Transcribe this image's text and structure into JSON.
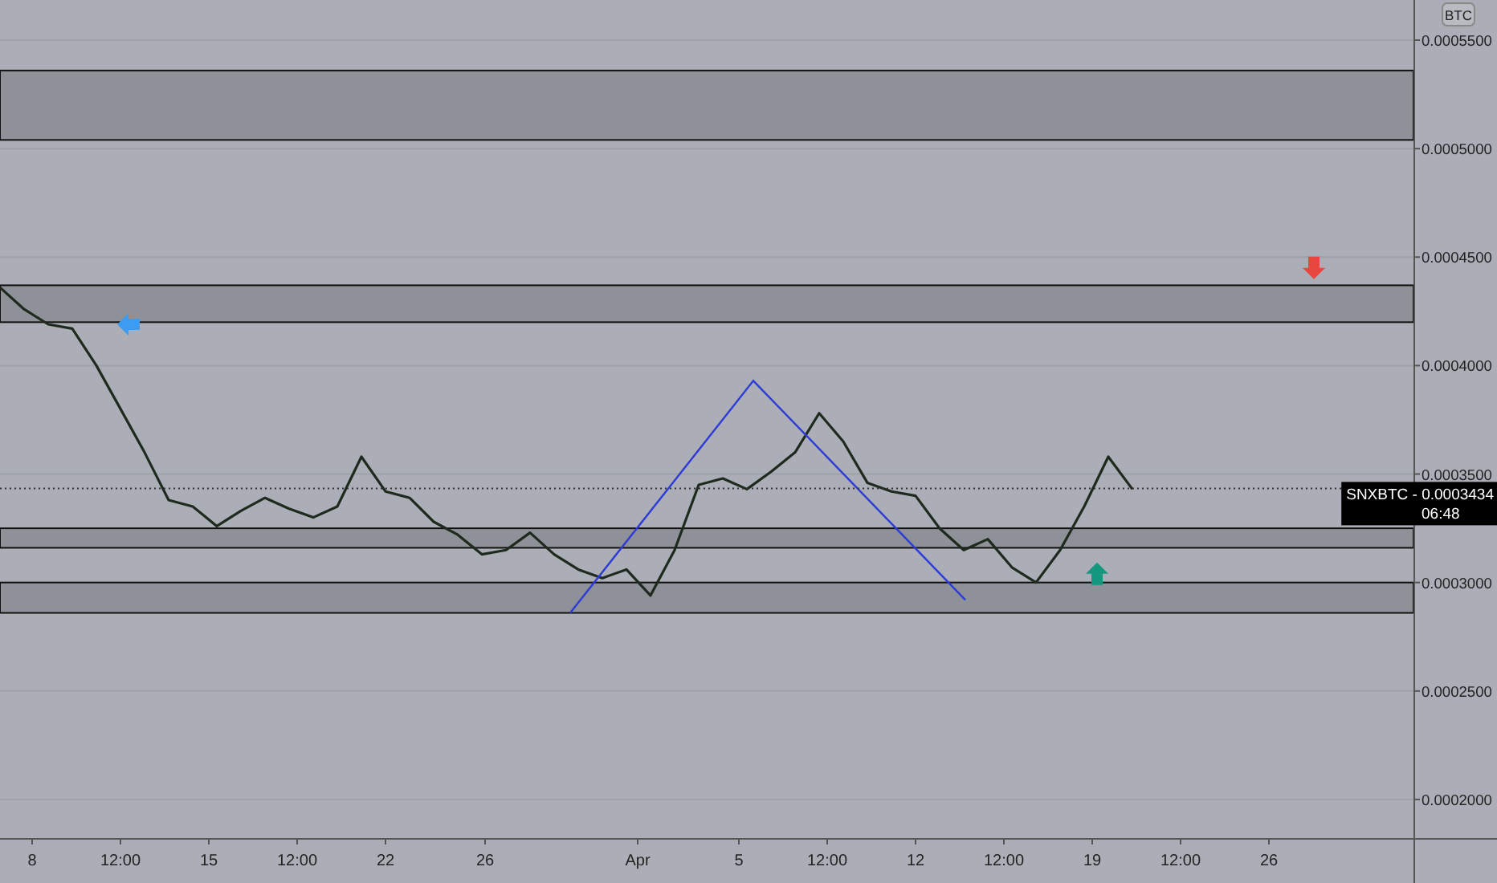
{
  "chart": {
    "currency_button": "BTC",
    "chart_data": {
      "type": "line",
      "grid": true,
      "series": [
        {
          "color": "#1e2a1e",
          "values": [
            0.000436,
            0.000426,
            0.000419,
            0.000417,
            0.0004,
            0.00038,
            0.00036,
            0.000338,
            0.000335,
            0.000326,
            0.000333,
            0.000339,
            0.000334,
            0.00033,
            0.000335,
            0.000358,
            0.000342,
            0.000339,
            0.000328,
            0.000322,
            0.000313,
            0.000315,
            0.000323,
            0.000313,
            0.000306,
            0.000302,
            0.000306,
            0.000294,
            0.000315,
            0.000345,
            0.000348,
            0.000343,
            0.000351,
            0.00036,
            0.000378,
            0.000365,
            0.000346,
            0.000342,
            0.00034,
            0.000325,
            0.000315,
            0.00032,
            0.000307,
            0.0003,
            0.000315,
            0.000335,
            0.000358,
            0.000343
          ]
        }
      ],
      "ylim": [
        0.0001615,
        0.0005685
      ],
      "yticks": [
        {
          "value": 0.00055,
          "label": "0.0005500"
        },
        {
          "value": 0.0005,
          "label": "0.0005000"
        },
        {
          "value": 0.00045,
          "label": "0.0004500"
        },
        {
          "value": 0.0004,
          "label": "0.0004000"
        },
        {
          "value": 0.00035,
          "label": "0.0003500"
        },
        {
          "value": 0.0003,
          "label": "0.0003000"
        },
        {
          "value": 0.00025,
          "label": "0.0002500"
        },
        {
          "value": 0.0002,
          "label": "0.0002000"
        }
      ]
    },
    "time_axis": [
      "8",
      "12:00",
      "15",
      "12:00",
      "22",
      "26",
      "Apr",
      "5",
      "12:00",
      "12",
      "12:00",
      "19",
      "12:00",
      "26"
    ],
    "price_tag": {
      "text": "SNXBTC - 0.0003434",
      "countdown": "06:48"
    }
  }
}
